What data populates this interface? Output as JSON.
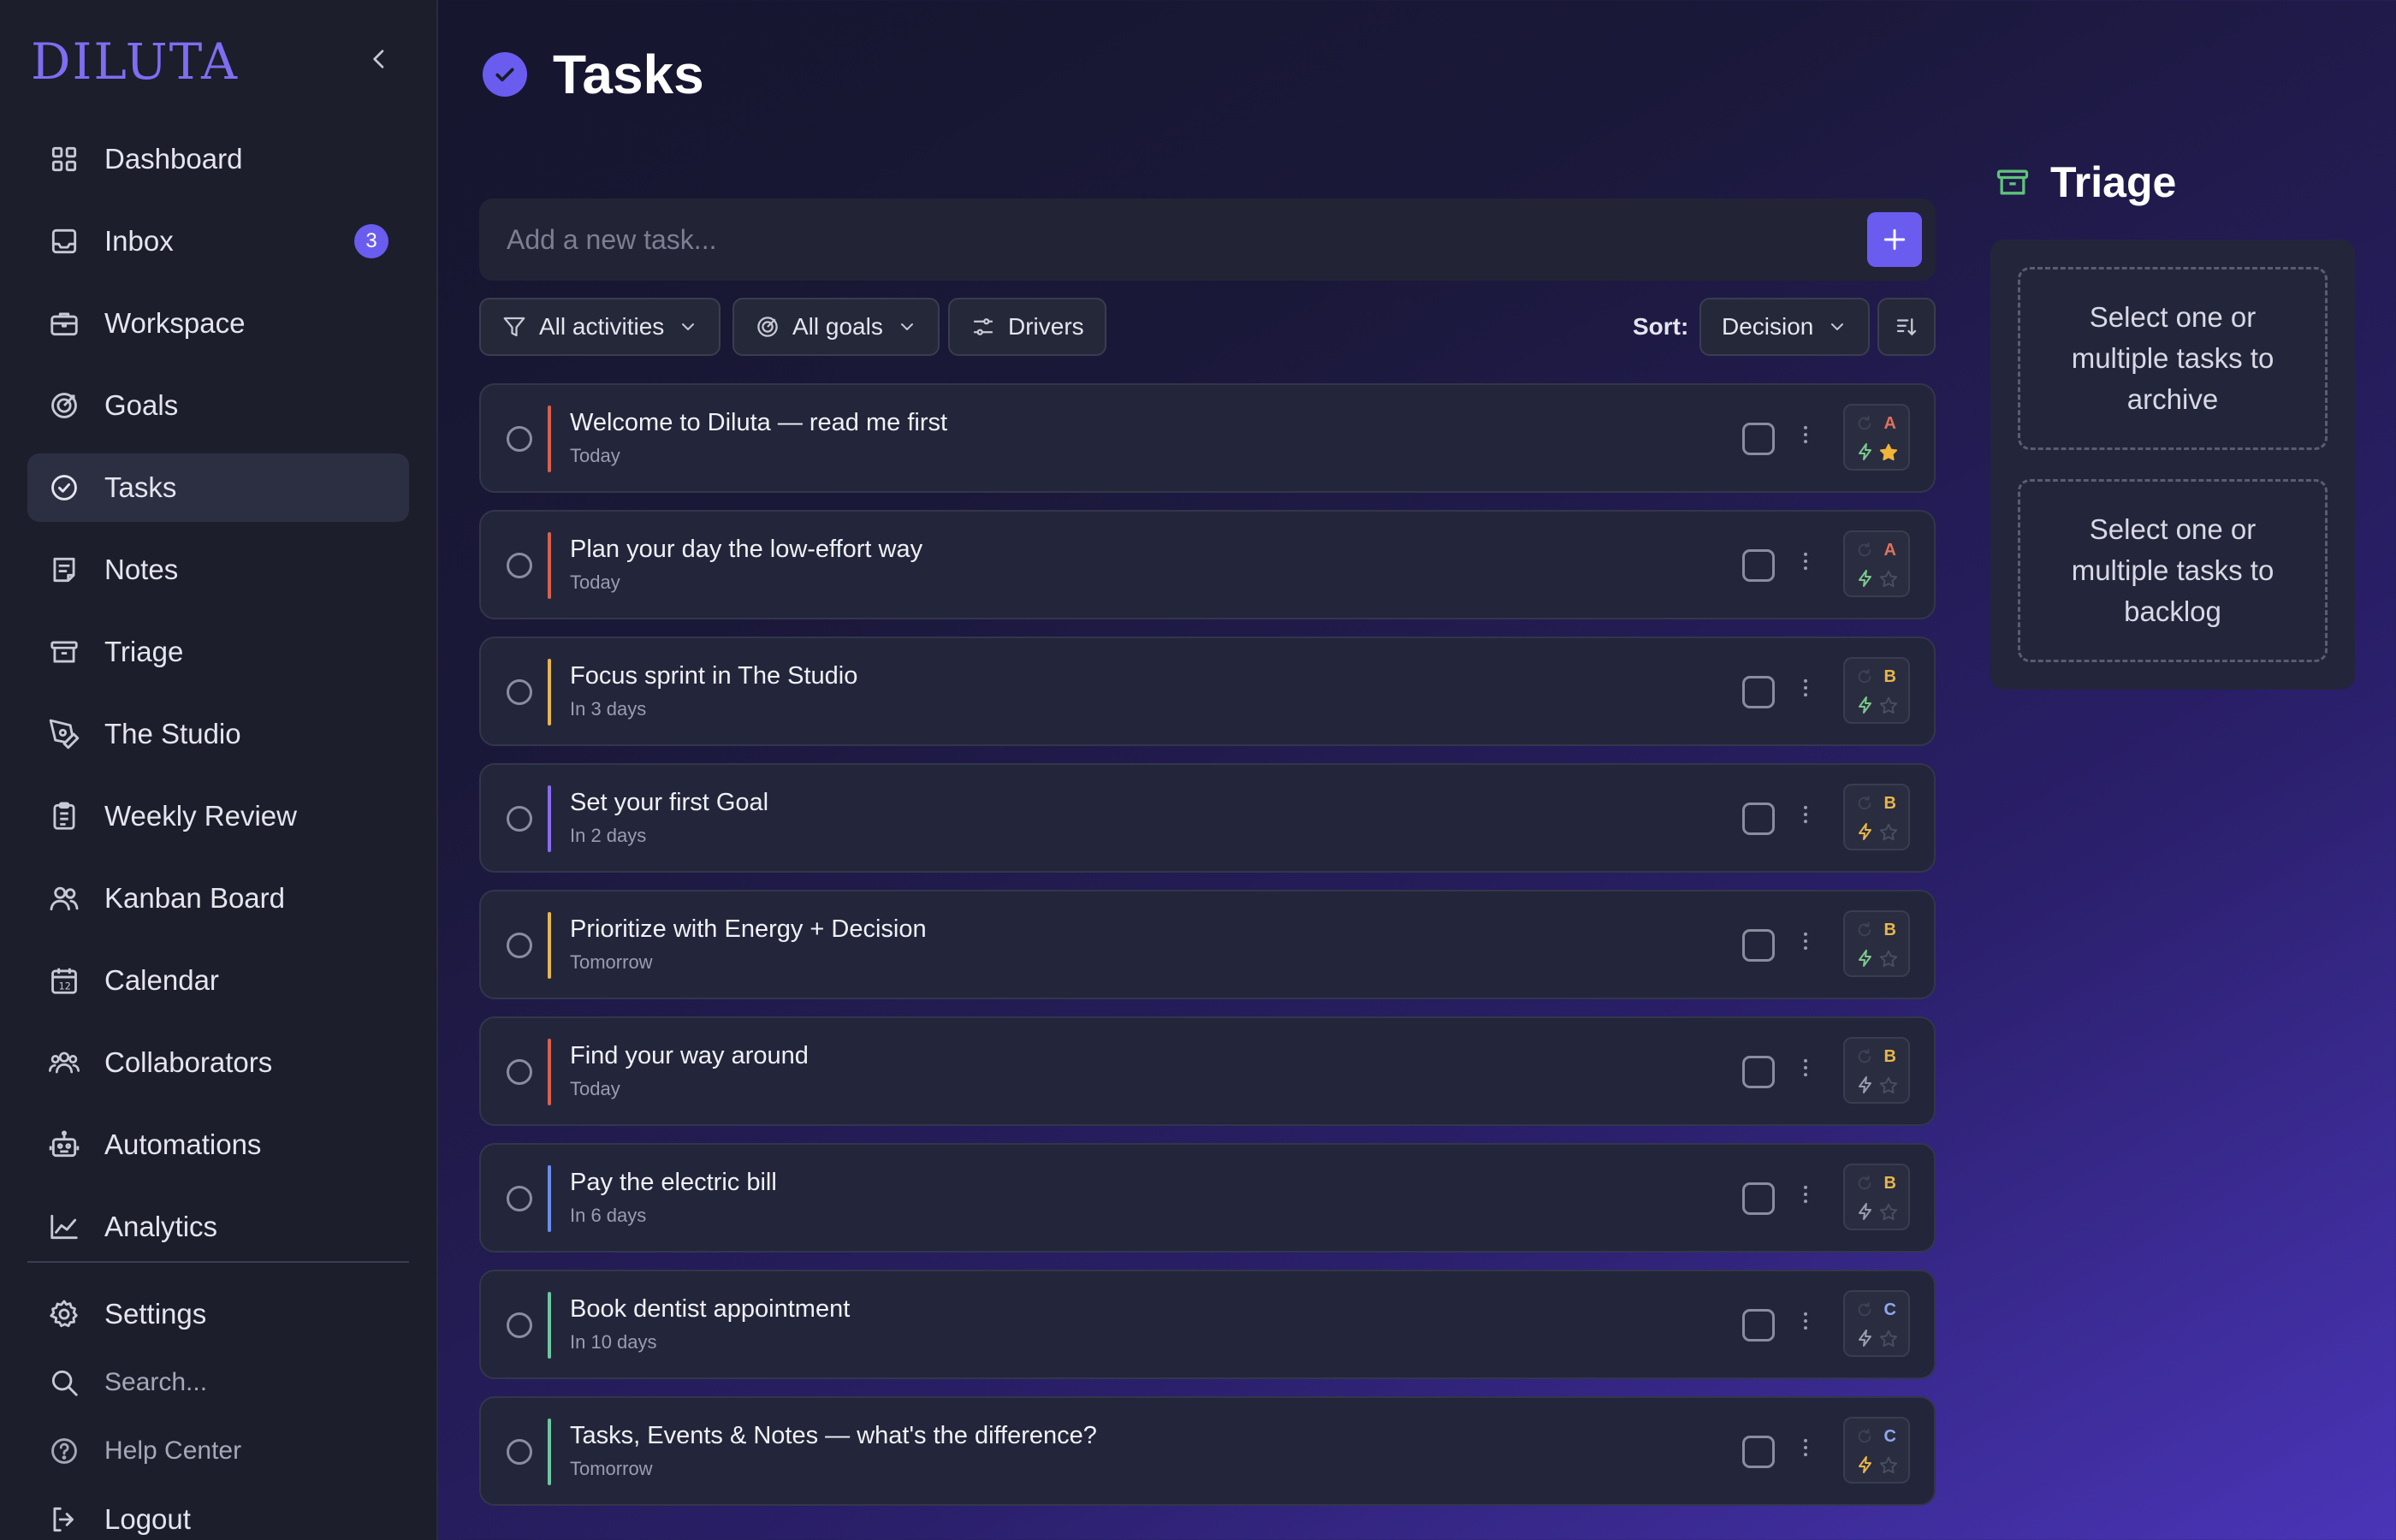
{
  "app": {
    "brand": "DILUTA"
  },
  "sidebar": {
    "items": [
      {
        "label": "Dashboard",
        "icon": "grid-icon"
      },
      {
        "label": "Inbox",
        "icon": "inbox-icon",
        "badge": "3"
      },
      {
        "label": "Workspace",
        "icon": "briefcase-icon"
      },
      {
        "label": "Goals",
        "icon": "target-icon"
      },
      {
        "label": "Tasks",
        "icon": "check-circle-icon",
        "active": true
      },
      {
        "label": "Notes",
        "icon": "note-icon"
      },
      {
        "label": "Triage",
        "icon": "archive-icon"
      },
      {
        "label": "The Studio",
        "icon": "pen-tool-icon"
      },
      {
        "label": "Weekly Review",
        "icon": "clipboard-icon"
      },
      {
        "label": "Kanban Board",
        "icon": "users-icon"
      },
      {
        "label": "Calendar",
        "icon": "calendar-icon"
      },
      {
        "label": "Collaborators",
        "icon": "collaborators-icon"
      },
      {
        "label": "Automations",
        "icon": "robot-icon"
      },
      {
        "label": "Analytics",
        "icon": "line-chart-icon"
      }
    ],
    "footer": {
      "settings": "Settings",
      "search": "Search...",
      "help": "Help Center",
      "logout": "Logout"
    }
  },
  "header": {
    "title": "Tasks"
  },
  "new_task": {
    "placeholder": "Add a new task..."
  },
  "filters": {
    "activities": "All activities",
    "goals": "All goals",
    "drivers": "Drivers",
    "sort_label": "Sort:",
    "sort_value": "Decision"
  },
  "tasks": [
    {
      "title": "Welcome to Diluta — read me first",
      "due": "Today",
      "stripe": "#d9604e",
      "grade": "A",
      "grade_color": "#e0715e",
      "bolt_color": "#7cc98c",
      "starred": true
    },
    {
      "title": "Plan your day the low-effort way",
      "due": "Today",
      "stripe": "#d9604e",
      "grade": "A",
      "grade_color": "#e0715e",
      "bolt_color": "#7cc98c",
      "starred": false
    },
    {
      "title": "Focus sprint in The Studio",
      "due": "In 3 days",
      "stripe": "#e8b64a",
      "grade": "B",
      "grade_color": "#e8b64a",
      "bolt_color": "#7cc98c",
      "starred": false
    },
    {
      "title": "Set your first Goal",
      "due": "In 2 days",
      "stripe": "#8a6cf0",
      "grade": "B",
      "grade_color": "#e8b64a",
      "bolt_color": "#e8b64a",
      "starred": false
    },
    {
      "title": "Prioritize with Energy + Decision",
      "due": "Tomorrow",
      "stripe": "#e8b64a",
      "grade": "B",
      "grade_color": "#e8b64a",
      "bolt_color": "#7cc98c",
      "starred": false
    },
    {
      "title": "Find your way around",
      "due": "Today",
      "stripe": "#d9604e",
      "grade": "B",
      "grade_color": "#e8b64a",
      "bolt_color": "#9a9db0",
      "starred": false
    },
    {
      "title": "Pay the electric bill",
      "due": "In 6 days",
      "stripe": "#6a8ee8",
      "grade": "B",
      "grade_color": "#e8b64a",
      "bolt_color": "#9a9db0",
      "starred": false
    },
    {
      "title": "Book dentist appointment",
      "due": "In 10 days",
      "stripe": "#6fc6a0",
      "grade": "C",
      "grade_color": "#8fa8f0",
      "bolt_color": "#9a9db0",
      "starred": false
    },
    {
      "title": "Tasks, Events & Notes — what's the difference?",
      "due": "Tomorrow",
      "stripe": "#6fc6a0",
      "grade": "C",
      "grade_color": "#8fa8f0",
      "bolt_color": "#e8b64a",
      "starred": false
    }
  ],
  "triage": {
    "title": "Triage",
    "archive_hint": "Select one or multiple tasks to archive",
    "backlog_hint": "Select one or multiple tasks to backlog"
  },
  "colors": {
    "accent": "#6b5cf0",
    "triage_icon": "#5fc27a"
  }
}
